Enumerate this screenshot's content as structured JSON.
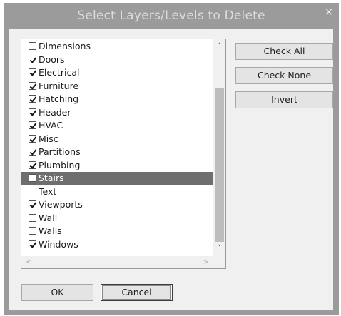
{
  "window": {
    "title": "Select Layers/Levels to Delete",
    "close_glyph": "×"
  },
  "layers": [
    {
      "label": "Dimensions",
      "checked": false,
      "selected": false
    },
    {
      "label": "Doors",
      "checked": true,
      "selected": false
    },
    {
      "label": "Electrical",
      "checked": true,
      "selected": false
    },
    {
      "label": "Furniture",
      "checked": true,
      "selected": false
    },
    {
      "label": "Hatching",
      "checked": true,
      "selected": false
    },
    {
      "label": "Header",
      "checked": true,
      "selected": false
    },
    {
      "label": "HVAC",
      "checked": true,
      "selected": false
    },
    {
      "label": "Misc",
      "checked": true,
      "selected": false
    },
    {
      "label": "Partitions",
      "checked": true,
      "selected": false
    },
    {
      "label": "Plumbing",
      "checked": true,
      "selected": false
    },
    {
      "label": "Stairs",
      "checked": false,
      "selected": true
    },
    {
      "label": "Text",
      "checked": false,
      "selected": false
    },
    {
      "label": "Viewports",
      "checked": true,
      "selected": false
    },
    {
      "label": "Wall",
      "checked": false,
      "selected": false
    },
    {
      "label": "Walls",
      "checked": false,
      "selected": false
    },
    {
      "label": "Windows",
      "checked": true,
      "selected": false
    }
  ],
  "buttons": {
    "check_all": "Check All",
    "check_none": "Check None",
    "invert": "Invert",
    "ok": "OK",
    "cancel": "Cancel"
  },
  "scroll": {
    "up": "˄",
    "down": "˅",
    "left": "<",
    "right": ">"
  }
}
